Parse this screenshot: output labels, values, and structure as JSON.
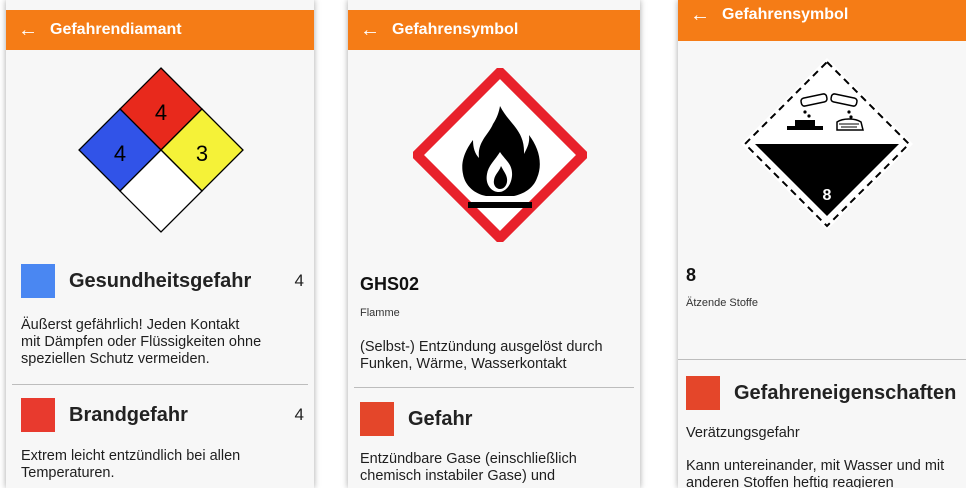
{
  "screens": [
    {
      "back_icon": "←",
      "title": "Gefahrendiamant",
      "diamond": {
        "top": "4",
        "left": "4",
        "right": "3",
        "bottom": "",
        "colors": {
          "top": "#e8291c",
          "left": "#3153e8",
          "right": "#f5f238",
          "bottom": "#ffffff"
        }
      },
      "sections": [
        {
          "label": "Gesundheitsgefahr",
          "value": "4",
          "color": "#4a87f2",
          "text": [
            "Äußerst gefährlich! Jeden Kontakt",
            "mit Dämpfen oder Flüssigkeiten ohne",
            "speziellen Schutz vermeiden."
          ]
        },
        {
          "label": "Brandgefahr",
          "value": "4",
          "color": "#e83a2e",
          "text": [
            "Extrem leicht entzündlich bei allen",
            "Temperaturen."
          ]
        }
      ]
    },
    {
      "back_icon": "←",
      "title": "Gefahrensymbol",
      "symbol_icon": "flame-pictogram",
      "code": "GHS02",
      "name": "Flamme",
      "description": [
        "(Selbst-) Entzündung ausgelöst durch",
        "Funken, Wärme, Wasserkontakt"
      ],
      "section": {
        "label": "Gefahr",
        "color": "#e4462a",
        "text": [
          "Entzündbare Gase (einschließlich",
          "chemisch instabiler Gase) und"
        ]
      }
    },
    {
      "back_icon": "←",
      "title": "Gefahrensymbol",
      "symbol_icon": "corrosive-class-8-label",
      "symbol_number": "8",
      "code": "8",
      "name": "Ätzende Stoffe",
      "section": {
        "label": "Gefahreneigenschaften",
        "color": "#e4462a",
        "subtitle": "Verätzungsgefahr",
        "text": [
          "Kann untereinander, mit Wasser und mit",
          "anderen Stoffen heftig reagieren"
        ]
      }
    }
  ]
}
